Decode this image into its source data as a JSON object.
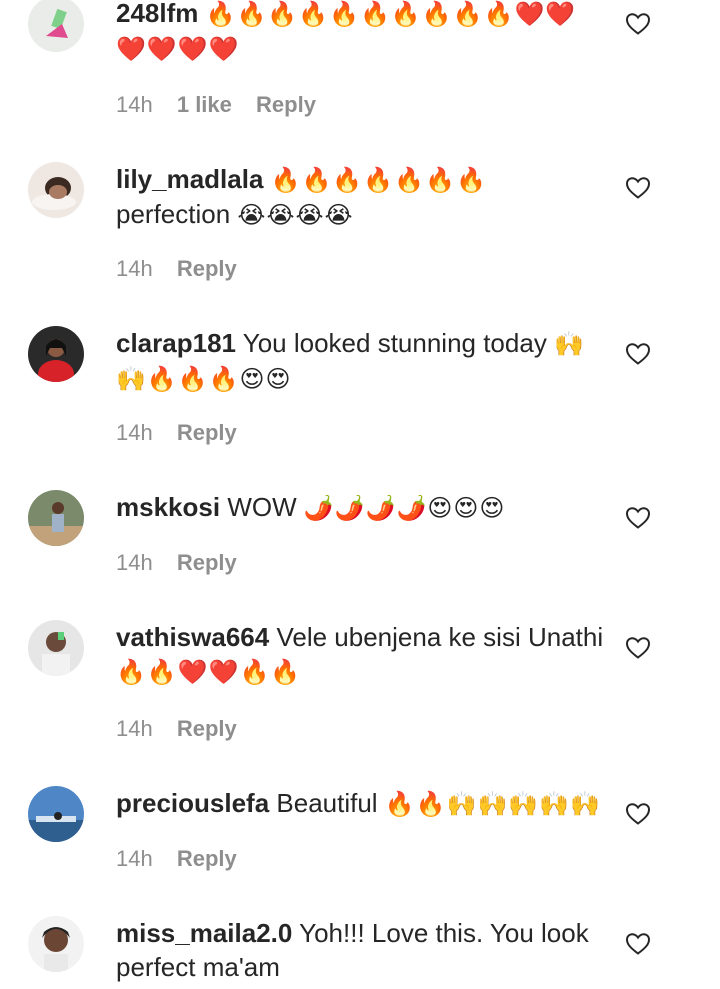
{
  "comments": [
    {
      "username": "248lfm",
      "text": "",
      "emojis": "🔥🔥🔥🔥🔥🔥🔥🔥🔥🔥❤️❤️❤️❤️❤️❤️",
      "time": "14h",
      "likes": "1 like",
      "reply": "Reply"
    },
    {
      "username": "lily_madlala",
      "text": "perfection",
      "emojis_before": "🔥🔥🔥🔥🔥🔥🔥",
      "emojis": "😭😭😭😭",
      "time": "14h",
      "reply": "Reply"
    },
    {
      "username": "clarap181",
      "text": "You looked stunning today",
      "emojis": "🙌🙌🔥🔥🔥😍😍",
      "time": "14h",
      "reply": "Reply"
    },
    {
      "username": "mskkosi",
      "text": "WOW",
      "emojis": "🌶️🌶️🌶️🌶️😍😍😍",
      "time": "14h",
      "reply": "Reply"
    },
    {
      "username": "vathiswa664",
      "text": "Vele ubenjena ke sisi Unathi",
      "emojis": "🔥🔥❤️❤️🔥🔥",
      "time": "14h",
      "reply": "Reply"
    },
    {
      "username": "preciouslefa",
      "text": "Beautiful",
      "emojis": "🔥🔥🙌🙌🙌🙌🙌",
      "time": "14h",
      "reply": "Reply"
    },
    {
      "username": "miss_maila2.0",
      "text": "Yoh!!! Love this. You look perfect ma'am",
      "emojis": "",
      "time": "",
      "reply": ""
    }
  ],
  "colors": {
    "text": "#262626",
    "meta": "#8e8e8e",
    "heart_stroke": "#262626"
  },
  "icons": {
    "like": "heart-outline-icon"
  }
}
